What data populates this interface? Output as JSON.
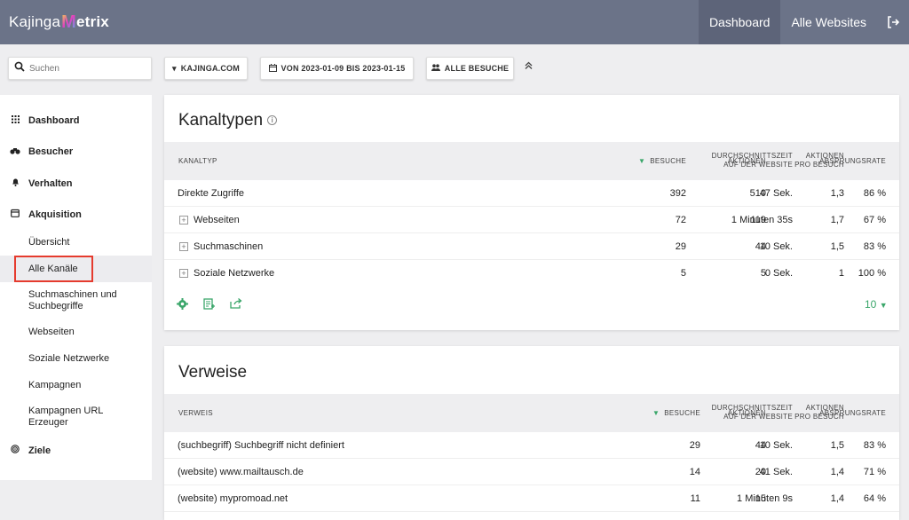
{
  "header": {
    "logo_prefix": "Kajinga",
    "logo_m": "M",
    "logo_suffix": "etrix",
    "nav": [
      "Dashboard",
      "Alle Websites"
    ],
    "logout_icon": "logout-icon"
  },
  "toolbar": {
    "search_placeholder": "Suchen",
    "site": "KAJINGA.COM",
    "date_range": "VON 2023-01-09 BIS 2023-01-15",
    "segment": "ALLE BESUCHE"
  },
  "sidebar": {
    "main": [
      {
        "label": "Dashboard",
        "icon": "grid-icon"
      },
      {
        "label": "Besucher",
        "icon": "binoculars-icon"
      },
      {
        "label": "Verhalten",
        "icon": "bell-icon"
      },
      {
        "label": "Akquisition",
        "icon": "calendar-icon"
      },
      {
        "label": "Ziele",
        "icon": "target-icon"
      }
    ],
    "sub": [
      "Übersicht",
      "Alle Kanäle",
      "Suchmaschinen und Suchbegriffe",
      "Webseiten",
      "Soziale Netzwerke",
      "Kampagnen",
      "Kampagnen URL Erzeuger"
    ]
  },
  "kanaltypen": {
    "title": "Kanaltypen",
    "columns": [
      "KANALTYP",
      "BESUCHE",
      "AKTIONEN",
      "AKTIONEN PRO BESUCH",
      "DURCHSCHNITTSZEIT AUF DER WEBSITE",
      "ABSPRUNGSRATE"
    ],
    "col_lines": {
      "aktionen_pro_besuch": [
        "AKTIONEN",
        "PRO BESUCH"
      ],
      "durchschnittszeit": [
        "DURCHSCHNITTSZEIT",
        "AUF DER WEBSITE"
      ]
    },
    "rows": [
      {
        "label": "Direkte Zugriffe",
        "expandable": false,
        "besuche": "392",
        "aktionen": "510",
        "pro_besuch": "1,3",
        "zeit": "47 Sek.",
        "rate": "86 %"
      },
      {
        "label": "Webseiten",
        "expandable": true,
        "besuche": "72",
        "aktionen": "119",
        "pro_besuch": "1,7",
        "zeit": "1 Minuten 35s",
        "rate": "67 %"
      },
      {
        "label": "Suchmaschinen",
        "expandable": true,
        "besuche": "29",
        "aktionen": "44",
        "pro_besuch": "1,5",
        "zeit": "10 Sek.",
        "rate": "83 %"
      },
      {
        "label": "Soziale Netzwerke",
        "expandable": true,
        "besuche": "5",
        "aktionen": "5",
        "pro_besuch": "1",
        "zeit": "0 Sek.",
        "rate": "100 %"
      }
    ],
    "footer_icons": [
      "settings-icon",
      "export-table-icon",
      "share-icon"
    ],
    "limit": "10"
  },
  "verweise": {
    "title": "Verweise",
    "columns": [
      "VERWEIS",
      "BESUCHE",
      "AKTIONEN",
      "AKTIONEN PRO BESUCH",
      "DURCHSCHNITTSZEIT AUF DER WEBSITE",
      "ABSPRUNGSRATE"
    ],
    "rows": [
      {
        "label": "(suchbegriff) Suchbegriff nicht definiert",
        "besuche": "29",
        "aktionen": "44",
        "pro_besuch": "1,5",
        "zeit": "10 Sek.",
        "rate": "83 %"
      },
      {
        "label": "(website) www.mailtausch.de",
        "besuche": "14",
        "aktionen": "20",
        "pro_besuch": "1,4",
        "zeit": "41 Sek.",
        "rate": "71 %"
      },
      {
        "label": "(website) mypromoad.net",
        "besuche": "11",
        "aktionen": "15",
        "pro_besuch": "1,4",
        "zeit": "1 Minuten 9s",
        "rate": "64 %"
      }
    ]
  },
  "colors": {
    "topbar": "#6b7388",
    "accent_green": "#3aa66a",
    "highlight_red": "#e53b2e"
  }
}
